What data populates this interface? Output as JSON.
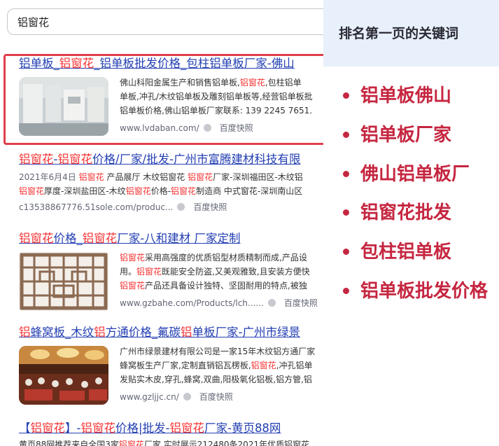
{
  "search": {
    "value": "铝窗花"
  },
  "results": [
    {
      "title_parts": [
        "铝单板_",
        "铝窗花",
        "_铝单板批发价格_包柱铝单板厂家-佛山"
      ],
      "lines": [
        [
          "佛山科阳金属生产和销售铝单板,",
          "铝窗花",
          ",包柱铝单"
        ],
        [
          "单板,冲孔/木纹铝单板及雕刻铝单板等,经营铝单板批"
        ],
        [
          "铝单板价格,佛山铝单板厂家联系: 139 2245 7651."
        ]
      ],
      "source": "www.lvdaban.com/",
      "snapshot": "百度快照"
    },
    {
      "title_parts": [
        "铝窗花",
        "-",
        "铝窗花",
        "价格/厂家/批发-广州市富腾建材科技有限"
      ],
      "lines": [
        [
          "2021年6月4日 ",
          "铝窗花",
          " 产品展厅 木纹铝窗花 ",
          "铝窗花",
          "厂家-深圳福田区-木纹铝"
        ],
        [
          "铝窗花",
          "厚度-深圳盐田区-木纹",
          "铝窗花",
          "价格-",
          "铝窗花",
          "制造商 中式窗花-深圳南山区"
        ]
      ],
      "source": "c13538867776.51sole.com/produc...",
      "snapshot": "百度快照"
    },
    {
      "title_parts": [
        "铝窗花",
        "价格_",
        "铝窗花",
        "厂家-八和建材 厂家定制"
      ],
      "lines": [
        [
          "铝窗花",
          "采用高强度的优质铝型材质精制而成,产品设"
        ],
        [
          "用。",
          "铝窗花",
          "既能安全防盗,又美观雅致,且安装方便快"
        ],
        [
          "铝窗花",
          "产品还具备设计独特、坚固耐用的特点,被独"
        ]
      ],
      "source": "www.gzbahe.com/Products/lch......",
      "snapshot": "百度快照"
    },
    {
      "title_parts": [
        "铝",
        "蜂窝板_木纹",
        "铝",
        "方通价格_氟碳",
        "铝",
        "单板厂家-广州市绿景"
      ],
      "lines": [
        [
          "广州市绿景建材有限公司是一家15年木纹铝方通厂家"
        ],
        [
          "蜂窝板生产厂家,定制直销铝瓦楞板,",
          "铝窗花",
          ",冲孔铝单"
        ],
        [
          "发贴实木皮,穿孔,蜂窝,双曲,阳极氧化铝板,铝方管,铝"
        ]
      ],
      "source": "www.gzljjc.cn/",
      "snapshot": "百度快照"
    },
    {
      "title_parts": [
        "【",
        "铝窗花",
        "】-",
        "铝窗花",
        "价格|批发-",
        "铝窗花",
        "厂家-黄页88网"
      ],
      "lines": [
        [
          "黄页88网推荐来自全国3家",
          "铝窗花",
          "厂家,实时展示212480条2021年优质铝窗花"
        ]
      ],
      "source": "",
      "snapshot": ""
    }
  ],
  "panel": {
    "title": "排名第一页的关键词",
    "keywords": [
      "铝单板佛山",
      "铝单板厂家",
      "佛山铝单板厂",
      "铝窗花批发",
      "包柱铝单板",
      "铝单板批发价格"
    ]
  },
  "colors": {
    "highlight": "#f73131",
    "link": "#2440b3",
    "keyword": "#c52640",
    "box": "#e0404a"
  }
}
